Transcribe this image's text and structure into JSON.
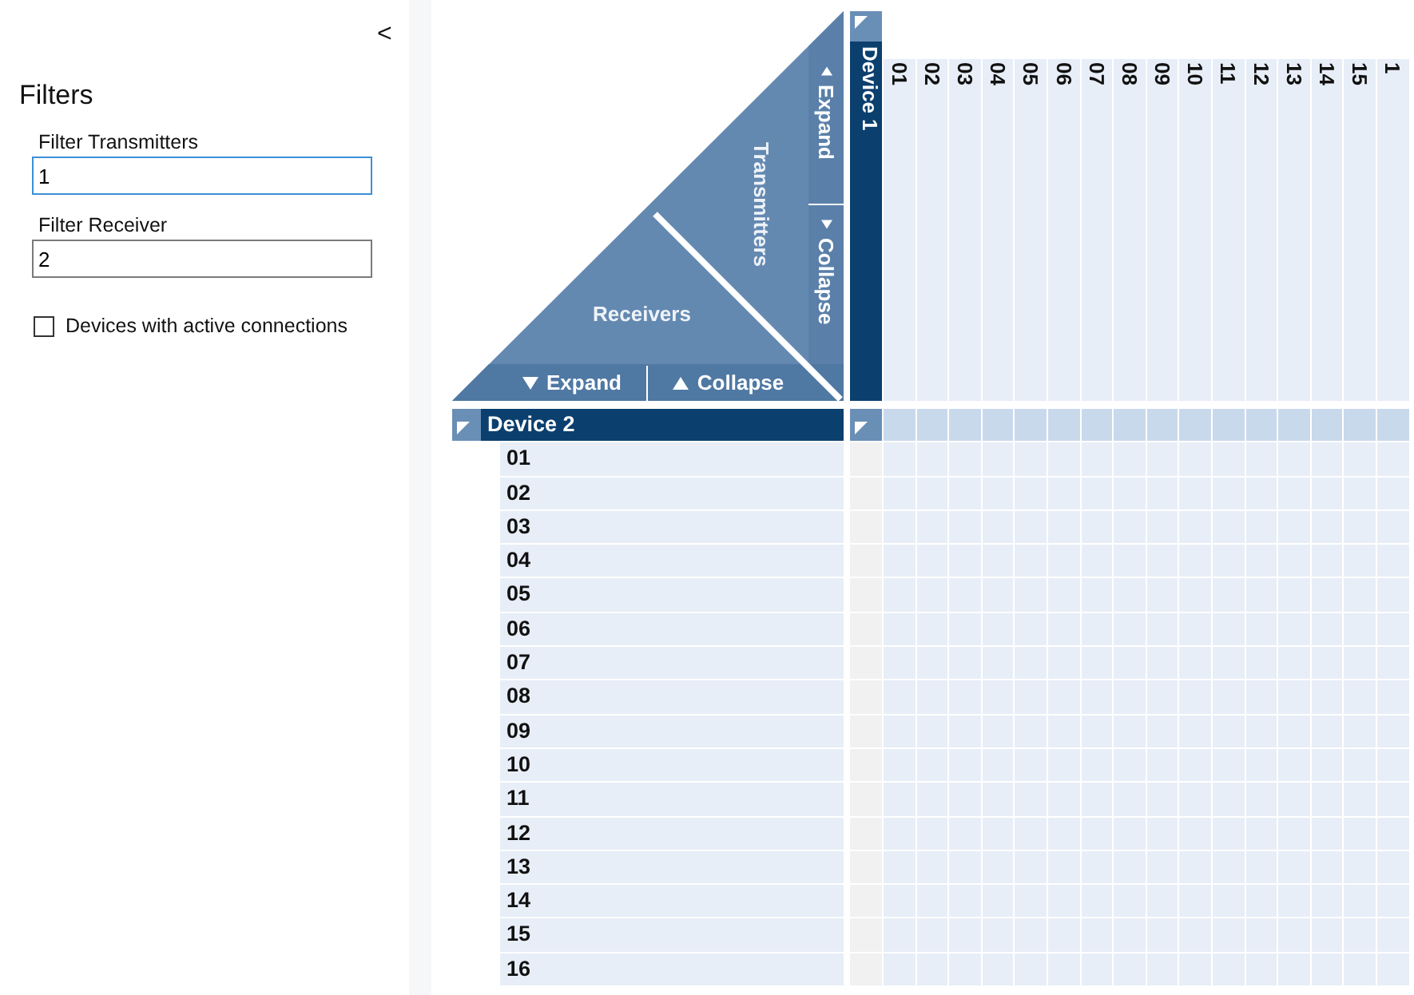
{
  "sidebar": {
    "collapse_button": "<",
    "title": "Filters",
    "fields": [
      {
        "label": "Filter Transmitters",
        "value": "1",
        "focused": true
      },
      {
        "label": "Filter Receiver",
        "value": "2",
        "focused": false
      }
    ],
    "checkbox": {
      "label": "Devices with active connections",
      "checked": false
    }
  },
  "matrix": {
    "corner": {
      "transmitters_label": "Transmitters",
      "receivers_label": "Receivers",
      "transmitter_buttons": [
        {
          "label": "Expand",
          "kind": "expand"
        },
        {
          "label": "Collapse",
          "kind": "collapse"
        }
      ],
      "receiver_buttons": [
        {
          "label": "Expand",
          "kind": "expand"
        },
        {
          "label": "Collapse",
          "kind": "collapse"
        }
      ]
    },
    "transmitter_device": "Device 1",
    "columns": [
      "01",
      "02",
      "03",
      "04",
      "05",
      "06",
      "07",
      "08",
      "09",
      "10",
      "11",
      "12",
      "13",
      "14",
      "15",
      "1"
    ],
    "receiver_device": "Device 2",
    "rows": [
      "01",
      "02",
      "03",
      "04",
      "05",
      "06",
      "07",
      "08",
      "09",
      "10",
      "11",
      "12",
      "13",
      "14",
      "15",
      "16"
    ]
  }
}
